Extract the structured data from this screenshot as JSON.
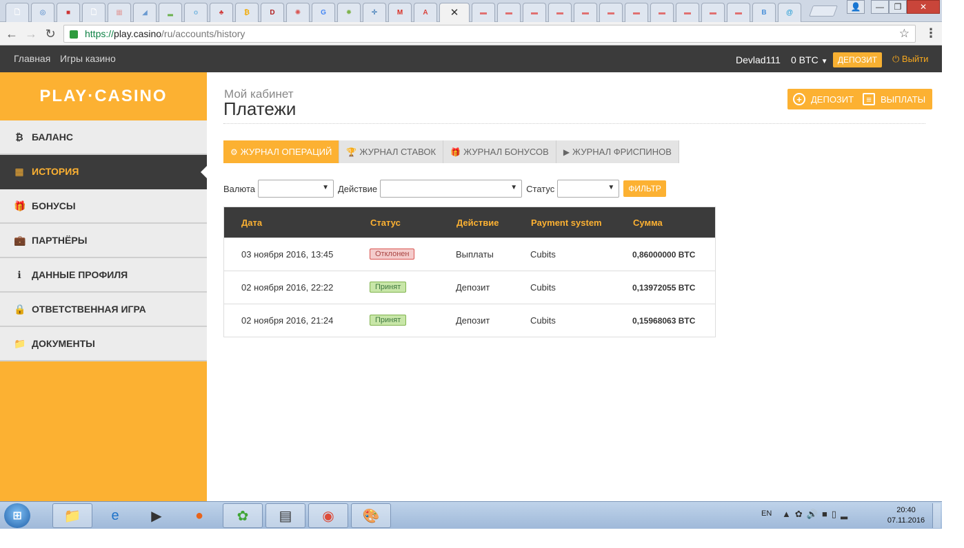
{
  "browser": {
    "tabs": [
      {
        "icon": "blank-page-icon",
        "color": "#ffffff",
        "glyph": "🗋"
      },
      {
        "icon": "globe-icon",
        "color": "#3b7ac2",
        "glyph": "◎"
      },
      {
        "icon": "flag-icon",
        "color": "#cc3333",
        "glyph": "■"
      },
      {
        "icon": "blank-page-icon",
        "color": "#ffffff",
        "glyph": "🗋"
      },
      {
        "icon": "site-icon",
        "color": "#e0a0a0",
        "glyph": "▦"
      },
      {
        "icon": "chart-icon",
        "color": "#6b9bd1",
        "glyph": "◢"
      },
      {
        "icon": "bars-icon",
        "color": "#6ab04c",
        "glyph": "▂"
      },
      {
        "icon": "ow-icon",
        "color": "#7ab8e0",
        "glyph": "o"
      },
      {
        "icon": "cherry-icon",
        "color": "#d13b3b",
        "glyph": "♣"
      },
      {
        "icon": "bitcoin-icon",
        "color": "#f2a900",
        "glyph": "₿"
      },
      {
        "icon": "d-icon",
        "color": "#b21e1e",
        "glyph": "D"
      },
      {
        "icon": "gear-icon",
        "color": "#d9534f",
        "glyph": "✺"
      },
      {
        "icon": "google-icon",
        "color": "#4285f4",
        "glyph": "G"
      },
      {
        "icon": "puzzle-icon",
        "color": "#7fb34d",
        "glyph": "✹"
      },
      {
        "icon": "crosshair-icon",
        "color": "#2c6fb0",
        "glyph": "✛"
      },
      {
        "icon": "gmail-icon",
        "color": "#d93025",
        "glyph": "M"
      },
      {
        "icon": "a-icon",
        "color": "#d9443d",
        "glyph": "A"
      },
      {
        "icon": "car-icon",
        "color": "#e07070",
        "glyph": "▬"
      },
      {
        "icon": "car-icon",
        "color": "#e07070",
        "glyph": "▬"
      },
      {
        "icon": "car-icon",
        "color": "#e07070",
        "glyph": "▬"
      },
      {
        "icon": "car-icon",
        "color": "#e07070",
        "glyph": "▬"
      },
      {
        "icon": "car-icon",
        "color": "#e07070",
        "glyph": "▬"
      },
      {
        "icon": "car-icon",
        "color": "#e07070",
        "glyph": "▬"
      },
      {
        "icon": "car-icon",
        "color": "#e07070",
        "glyph": "▬"
      },
      {
        "icon": "car-icon",
        "color": "#e07070",
        "glyph": "▬"
      },
      {
        "icon": "car-icon",
        "color": "#e07070",
        "glyph": "▬"
      },
      {
        "icon": "car-icon",
        "color": "#e07070",
        "glyph": "▬"
      },
      {
        "icon": "car-icon",
        "color": "#e07070",
        "glyph": "▬"
      },
      {
        "icon": "b-icon",
        "color": "#4a90d9",
        "glyph": "B"
      },
      {
        "icon": "at-icon",
        "color": "#2a9fd6",
        "glyph": "@"
      }
    ],
    "active_tab_close": "✕",
    "url": {
      "scheme": "https://",
      "host": "play.casino",
      "path": "/ru/accounts/history"
    }
  },
  "topnav": {
    "links": [
      "Главная",
      "Игры казино"
    ],
    "username": "Devlad111",
    "balance": "0 BTC",
    "deposit_label": "ДЕПОЗИТ",
    "logout_label": "Выйти"
  },
  "sidebar": {
    "logo": "PLAY·CASINO",
    "items": [
      {
        "icon": "₿",
        "label": "БАЛАНС"
      },
      {
        "icon": "▦",
        "label": "ИСТОРИЯ"
      },
      {
        "icon": "🎁",
        "label": "БОНУСЫ"
      },
      {
        "icon": "💼",
        "label": "ПАРТНЁРЫ"
      },
      {
        "icon": "ℹ",
        "label": "ДАННЫЕ ПРОФИЛЯ"
      },
      {
        "icon": "🔒",
        "label": "ОТВЕТСТВЕННАЯ ИГРА"
      },
      {
        "icon": "📁",
        "label": "ДОКУМЕНТЫ"
      }
    ]
  },
  "main": {
    "crumb": "Мой кабинет",
    "title": "Платежи",
    "deposit_label": "ДЕПОЗИТ",
    "payouts_label": "ВЫПЛАТЫ",
    "tabs": [
      {
        "icon": "⚙",
        "label": "ЖУРНАЛ ОПЕРАЦИЙ"
      },
      {
        "icon": "🏆",
        "label": "ЖУРНАЛ СТАВОК"
      },
      {
        "icon": "🎁",
        "label": "ЖУРНАЛ БОНУСОВ"
      },
      {
        "icon": "▶",
        "label": "ЖУРНАЛ ФРИСПИНОВ"
      }
    ],
    "filters": {
      "currency_label": "Валюта",
      "action_label": "Действие",
      "status_label": "Статус",
      "currency_value": "",
      "action_value": "",
      "status_value": "",
      "filter_button": "ФИЛЬТР"
    },
    "table": {
      "headers": [
        "Дата",
        "Статус",
        "Действие",
        "Payment system",
        "Сумма"
      ],
      "rows": [
        {
          "date": "03 ноября 2016, 13:45",
          "status": "Отклонен",
          "status_type": "rejected",
          "action": "Выплаты",
          "system": "Cubits",
          "amount": "0,86000000 BTC"
        },
        {
          "date": "02 ноября 2016, 22:22",
          "status": "Принят",
          "status_type": "accepted",
          "action": "Депозит",
          "system": "Cubits",
          "amount": "0,13972055 BTC"
        },
        {
          "date": "02 ноября 2016, 21:24",
          "status": "Принят",
          "status_type": "accepted",
          "action": "Депозит",
          "system": "Cubits",
          "amount": "0,15968063 BTC"
        }
      ]
    }
  },
  "taskbar": {
    "lang": "EN",
    "time": "20:40",
    "date": "07.11.2016"
  },
  "colors": {
    "accent": "#fcb132",
    "dark": "#3b3b3b"
  }
}
